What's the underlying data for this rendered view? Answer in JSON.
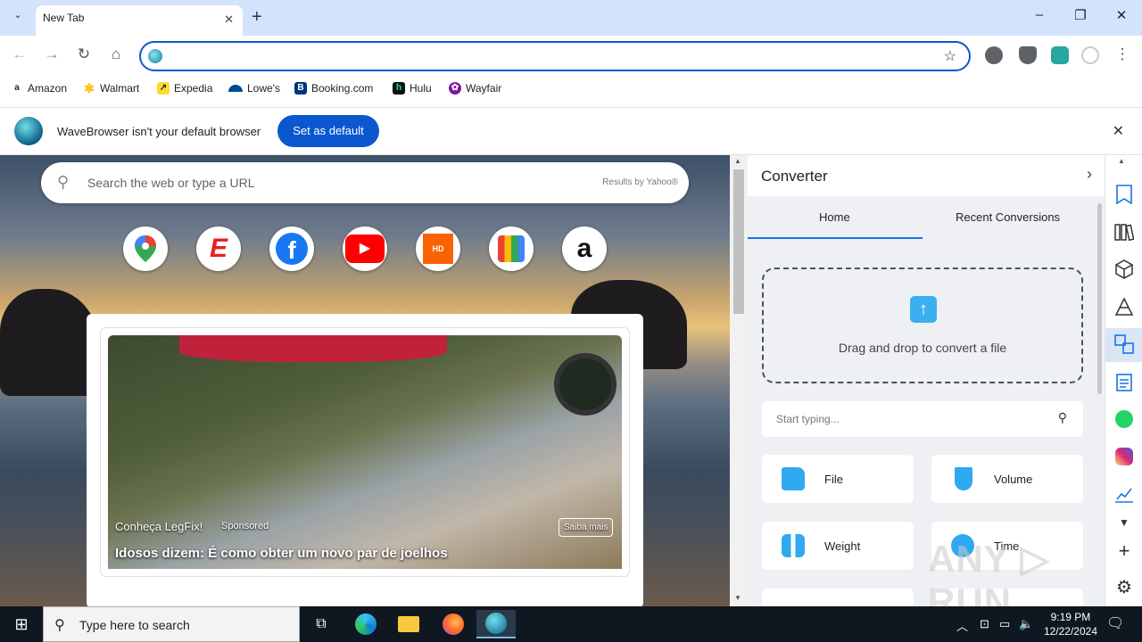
{
  "window": {
    "tab_title": "New Tab",
    "tab_close": "✕",
    "new_tab": "+",
    "minimize": "–",
    "restore": "❐",
    "close": "✕"
  },
  "toolbar": {
    "url_value": "",
    "back": "←",
    "forward": "→",
    "reload": "↻",
    "home": "⌂",
    "star": "☆",
    "menu": "⋮"
  },
  "bookmarks": [
    {
      "label": "Amazon",
      "icon": "a",
      "color": "#222222"
    },
    {
      "label": "Walmart",
      "icon": "✱",
      "color": "#ffc220"
    },
    {
      "label": "Expedia",
      "icon": "↗",
      "color": "#fddb32"
    },
    {
      "label": "Lowe's",
      "icon": "▬",
      "color": "#004990"
    },
    {
      "label": "Booking.com",
      "icon": "B",
      "color": "#003580"
    },
    {
      "label": "Hulu",
      "icon": "h",
      "color": "#1ce783"
    },
    {
      "label": "Wayfair",
      "icon": "✿",
      "color": "#7b189f"
    }
  ],
  "default_bar": {
    "message": "WaveBrowser isn't your default browser",
    "button": "Set as default",
    "close": "✕"
  },
  "newtab": {
    "search_placeholder": "Search the web or type a URL",
    "results_by": "Results by Yahoo®",
    "shortcuts": [
      {
        "name": "maps",
        "glyph": "📍",
        "color": "#34a853"
      },
      {
        "name": "espn",
        "glyph": "E",
        "color": "#e8201f"
      },
      {
        "name": "facebook",
        "glyph": "f",
        "color": "#1877f2"
      },
      {
        "name": "youtube",
        "glyph": "▶",
        "color": "#ff0000"
      },
      {
        "name": "homedepot",
        "glyph": "HD",
        "color": "#f96302"
      },
      {
        "name": "shop",
        "glyph": "🛍",
        "color": "#2b78e4"
      },
      {
        "name": "amazon",
        "glyph": "a",
        "color": "#111111"
      }
    ],
    "ad": {
      "brand": "Conheça LegFix!",
      "sponsored": "Sponsored",
      "title": "Idosos dizem: É como obter um novo par de joelhos",
      "cta": "Saiba mais"
    }
  },
  "converter": {
    "title": "Converter",
    "chevron": "›",
    "tabs": [
      "Home",
      "Recent Conversions"
    ],
    "drop_text": "Drag and drop to convert a file",
    "upload_arrow": "↑",
    "search_placeholder": "Start typing...",
    "search_icon": "🔍",
    "categories": [
      {
        "label": "File",
        "color": "#2fa9f0"
      },
      {
        "label": "Volume",
        "color": "#2fa9f0"
      },
      {
        "label": "Weight",
        "color": "#2fa9f0"
      },
      {
        "label": "Time",
        "color": "#2fa9f0"
      }
    ]
  },
  "sidebar_icons": [
    "bookmark-star-icon",
    "books-icon",
    "cube-icon",
    "triangle-shapes-icon",
    "translate-converter-icon",
    "notes-icon",
    "whatsapp-icon",
    "instagram-icon",
    "chart-icon",
    "chevron-down-icon",
    "plus-icon",
    "gear-icon"
  ],
  "taskbar": {
    "search_placeholder": "Type here to search",
    "time": "9:19 PM",
    "date": "12/22/2024"
  },
  "watermark": "ANY ▷ RUN"
}
